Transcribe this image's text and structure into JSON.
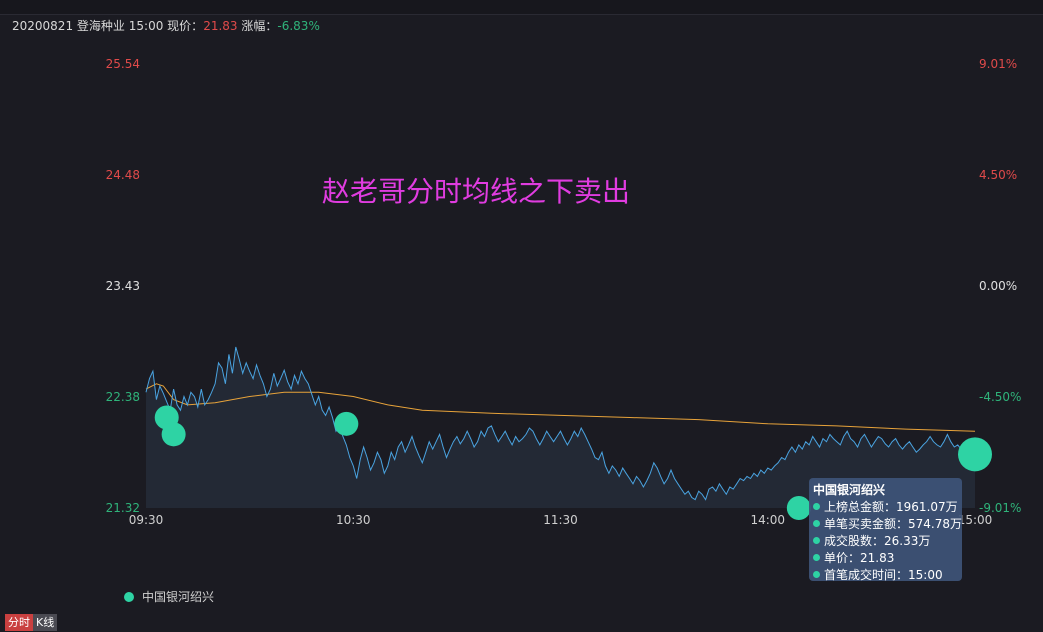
{
  "header": {
    "date": "20200821",
    "stock_name": "登海种业",
    "time": "15:00",
    "price_label": "现价：",
    "price_value": "21.83",
    "change_label": "涨幅：",
    "change_value": "-6.83%"
  },
  "annotation": "赵老哥分时均线之下卖出",
  "tooltip": {
    "title": "中国银河绍兴",
    "rows": [
      {
        "label": "上榜总金额",
        "value": "1961.07万"
      },
      {
        "label": "单笔买卖金额",
        "value": "574.78万"
      },
      {
        "label": "成交股数",
        "value": "26.33万"
      },
      {
        "label": "单价",
        "value": "21.83"
      },
      {
        "label": "首笔成交时间",
        "value": "15:00"
      }
    ]
  },
  "legend": {
    "series_name": "中国银河绍兴"
  },
  "tabs": [
    {
      "label": "分时",
      "active": true
    },
    {
      "label": "K线",
      "active": false
    }
  ],
  "colors": {
    "price_line": "#4aa3e0",
    "avg_line": "#e8a33a",
    "marker": "#2ed3a4",
    "up": "#e04a4a",
    "down": "#2fb37a",
    "neutral": "#e0e0e0"
  },
  "chart_data": {
    "type": "line",
    "title": "",
    "xlabel": "",
    "ylabel": "",
    "ylim": [
      21.32,
      25.54
    ],
    "y_ticks_left": [
      "25.54",
      "24.48",
      "23.43",
      "22.38",
      "21.32"
    ],
    "y_ticks_right": [
      "9.01%",
      "4.50%",
      "0.00%",
      "-4.50%",
      "-9.01%"
    ],
    "x_ticks": [
      "09:30",
      "10:30",
      "11:30",
      "14:00",
      "15:00"
    ],
    "grid": false,
    "legend_position": "bottom-left",
    "minutes_total": 240,
    "series": [
      {
        "kind": "price",
        "points": [
          [
            0,
            22.42
          ],
          [
            1,
            22.55
          ],
          [
            2,
            22.62
          ],
          [
            3,
            22.35
          ],
          [
            4,
            22.48
          ],
          [
            5,
            22.41
          ],
          [
            6,
            22.33
          ],
          [
            7,
            22.25
          ],
          [
            8,
            22.45
          ],
          [
            9,
            22.3
          ],
          [
            10,
            22.25
          ],
          [
            11,
            22.38
          ],
          [
            12,
            22.3
          ],
          [
            13,
            22.42
          ],
          [
            14,
            22.38
          ],
          [
            15,
            22.28
          ],
          [
            16,
            22.45
          ],
          [
            17,
            22.3
          ],
          [
            18,
            22.35
          ],
          [
            19,
            22.42
          ],
          [
            20,
            22.5
          ],
          [
            21,
            22.7
          ],
          [
            22,
            22.65
          ],
          [
            23,
            22.5
          ],
          [
            24,
            22.78
          ],
          [
            25,
            22.6
          ],
          [
            26,
            22.85
          ],
          [
            27,
            22.73
          ],
          [
            28,
            22.6
          ],
          [
            29,
            22.7
          ],
          [
            30,
            22.62
          ],
          [
            31,
            22.55
          ],
          [
            32,
            22.68
          ],
          [
            33,
            22.58
          ],
          [
            34,
            22.5
          ],
          [
            35,
            22.38
          ],
          [
            36,
            22.45
          ],
          [
            37,
            22.6
          ],
          [
            38,
            22.48
          ],
          [
            39,
            22.55
          ],
          [
            40,
            22.63
          ],
          [
            41,
            22.52
          ],
          [
            42,
            22.45
          ],
          [
            43,
            22.58
          ],
          [
            44,
            22.5
          ],
          [
            45,
            22.62
          ],
          [
            46,
            22.55
          ],
          [
            47,
            22.5
          ],
          [
            48,
            22.4
          ],
          [
            49,
            22.3
          ],
          [
            50,
            22.38
          ],
          [
            51,
            22.25
          ],
          [
            52,
            22.2
          ],
          [
            53,
            22.28
          ],
          [
            54,
            22.18
          ],
          [
            55,
            22.05
          ],
          [
            56,
            22.1
          ],
          [
            57,
            22.0
          ],
          [
            58,
            21.92
          ],
          [
            59,
            21.8
          ],
          [
            60,
            21.72
          ],
          [
            61,
            21.6
          ],
          [
            62,
            21.78
          ],
          [
            63,
            21.9
          ],
          [
            64,
            21.8
          ],
          [
            65,
            21.68
          ],
          [
            66,
            21.75
          ],
          [
            67,
            21.85
          ],
          [
            68,
            21.78
          ],
          [
            69,
            21.65
          ],
          [
            70,
            21.72
          ],
          [
            71,
            21.85
          ],
          [
            72,
            21.78
          ],
          [
            73,
            21.9
          ],
          [
            74,
            21.95
          ],
          [
            75,
            21.85
          ],
          [
            76,
            21.92
          ],
          [
            77,
            22.0
          ],
          [
            78,
            21.9
          ],
          [
            79,
            21.82
          ],
          [
            80,
            21.75
          ],
          [
            81,
            21.85
          ],
          [
            82,
            21.95
          ],
          [
            83,
            21.88
          ],
          [
            84,
            21.95
          ],
          [
            85,
            22.02
          ],
          [
            86,
            21.9
          ],
          [
            87,
            21.8
          ],
          [
            88,
            21.88
          ],
          [
            89,
            21.95
          ],
          [
            90,
            22.0
          ],
          [
            91,
            21.93
          ],
          [
            92,
            21.98
          ],
          [
            93,
            22.05
          ],
          [
            94,
            21.98
          ],
          [
            95,
            21.9
          ],
          [
            96,
            21.95
          ],
          [
            97,
            22.05
          ],
          [
            98,
            22.0
          ],
          [
            99,
            22.08
          ],
          [
            100,
            22.1
          ],
          [
            101,
            22.02
          ],
          [
            102,
            21.95
          ],
          [
            103,
            22.0
          ],
          [
            104,
            22.05
          ],
          [
            105,
            21.98
          ],
          [
            106,
            21.92
          ],
          [
            107,
            22.0
          ],
          [
            108,
            21.95
          ],
          [
            109,
            21.98
          ],
          [
            110,
            22.02
          ],
          [
            111,
            22.08
          ],
          [
            112,
            22.05
          ],
          [
            113,
            21.98
          ],
          [
            114,
            21.92
          ],
          [
            115,
            21.98
          ],
          [
            116,
            22.05
          ],
          [
            117,
            22.0
          ],
          [
            118,
            21.95
          ],
          [
            119,
            22.0
          ],
          [
            120,
            22.05
          ],
          [
            121,
            21.98
          ],
          [
            122,
            21.92
          ],
          [
            123,
            21.98
          ],
          [
            124,
            22.05
          ],
          [
            125,
            22.0
          ],
          [
            126,
            22.08
          ],
          [
            127,
            22.02
          ],
          [
            128,
            21.95
          ],
          [
            129,
            21.88
          ],
          [
            130,
            21.8
          ],
          [
            131,
            21.78
          ],
          [
            132,
            21.85
          ],
          [
            133,
            21.72
          ],
          [
            134,
            21.65
          ],
          [
            135,
            21.72
          ],
          [
            136,
            21.68
          ],
          [
            137,
            21.62
          ],
          [
            138,
            21.7
          ],
          [
            139,
            21.65
          ],
          [
            140,
            21.6
          ],
          [
            141,
            21.55
          ],
          [
            142,
            21.62
          ],
          [
            143,
            21.58
          ],
          [
            144,
            21.52
          ],
          [
            145,
            21.58
          ],
          [
            146,
            21.65
          ],
          [
            147,
            21.75
          ],
          [
            148,
            21.7
          ],
          [
            149,
            21.62
          ],
          [
            150,
            21.55
          ],
          [
            151,
            21.6
          ],
          [
            152,
            21.68
          ],
          [
            153,
            21.6
          ],
          [
            154,
            21.55
          ],
          [
            155,
            21.5
          ],
          [
            156,
            21.45
          ],
          [
            157,
            21.48
          ],
          [
            158,
            21.42
          ],
          [
            159,
            21.4
          ],
          [
            160,
            21.48
          ],
          [
            161,
            21.45
          ],
          [
            162,
            21.4
          ],
          [
            163,
            21.5
          ],
          [
            164,
            21.52
          ],
          [
            165,
            21.48
          ],
          [
            166,
            21.55
          ],
          [
            167,
            21.5
          ],
          [
            168,
            21.45
          ],
          [
            169,
            21.52
          ],
          [
            170,
            21.5
          ],
          [
            171,
            21.55
          ],
          [
            172,
            21.6
          ],
          [
            173,
            21.58
          ],
          [
            174,
            21.62
          ],
          [
            175,
            21.6
          ],
          [
            176,
            21.65
          ],
          [
            177,
            21.62
          ],
          [
            178,
            21.68
          ],
          [
            179,
            21.65
          ],
          [
            180,
            21.7
          ],
          [
            181,
            21.68
          ],
          [
            182,
            21.72
          ],
          [
            183,
            21.75
          ],
          [
            184,
            21.8
          ],
          [
            185,
            21.78
          ],
          [
            186,
            21.85
          ],
          [
            187,
            21.9
          ],
          [
            188,
            21.85
          ],
          [
            189,
            21.92
          ],
          [
            190,
            21.88
          ],
          [
            191,
            21.95
          ],
          [
            192,
            21.92
          ],
          [
            193,
            22.0
          ],
          [
            194,
            21.95
          ],
          [
            195,
            21.9
          ],
          [
            196,
            21.98
          ],
          [
            197,
            21.95
          ],
          [
            198,
            22.02
          ],
          [
            199,
            21.98
          ],
          [
            200,
            21.95
          ],
          [
            201,
            21.92
          ],
          [
            202,
            22.0
          ],
          [
            203,
            22.05
          ],
          [
            204,
            21.98
          ],
          [
            205,
            21.95
          ],
          [
            206,
            21.9
          ],
          [
            207,
            21.98
          ],
          [
            208,
            22.02
          ],
          [
            209,
            21.96
          ],
          [
            210,
            21.9
          ],
          [
            211,
            21.95
          ],
          [
            212,
            22.0
          ],
          [
            213,
            21.98
          ],
          [
            214,
            21.93
          ],
          [
            215,
            21.9
          ],
          [
            216,
            21.95
          ],
          [
            217,
            21.98
          ],
          [
            218,
            21.92
          ],
          [
            219,
            21.88
          ],
          [
            220,
            21.92
          ],
          [
            221,
            21.95
          ],
          [
            222,
            21.9
          ],
          [
            223,
            21.85
          ],
          [
            224,
            21.88
          ],
          [
            225,
            21.92
          ],
          [
            226,
            21.95
          ],
          [
            227,
            22.0
          ],
          [
            228,
            21.95
          ],
          [
            229,
            21.92
          ],
          [
            230,
            21.9
          ],
          [
            231,
            21.95
          ],
          [
            232,
            22.02
          ],
          [
            233,
            21.95
          ],
          [
            234,
            21.9
          ],
          [
            235,
            21.92
          ],
          [
            236,
            21.88
          ],
          [
            237,
            21.85
          ],
          [
            238,
            21.88
          ],
          [
            239,
            21.85
          ],
          [
            240,
            21.83
          ]
        ]
      },
      {
        "kind": "average",
        "points": [
          [
            0,
            22.45
          ],
          [
            3,
            22.5
          ],
          [
            5,
            22.48
          ],
          [
            8,
            22.35
          ],
          [
            12,
            22.3
          ],
          [
            20,
            22.32
          ],
          [
            30,
            22.38
          ],
          [
            40,
            22.42
          ],
          [
            50,
            22.42
          ],
          [
            60,
            22.38
          ],
          [
            70,
            22.3
          ],
          [
            80,
            22.25
          ],
          [
            100,
            22.22
          ],
          [
            120,
            22.2
          ],
          [
            140,
            22.18
          ],
          [
            160,
            22.16
          ],
          [
            180,
            22.12
          ],
          [
            200,
            22.1
          ],
          [
            220,
            22.07
          ],
          [
            240,
            22.05
          ]
        ]
      },
      {
        "name": "中国银河绍兴",
        "kind": "markers",
        "points": [
          [
            6,
            22.18
          ],
          [
            8,
            22.02
          ],
          [
            58,
            22.12
          ],
          [
            189,
            21.32
          ],
          [
            240,
            21.83
          ]
        ]
      }
    ]
  }
}
